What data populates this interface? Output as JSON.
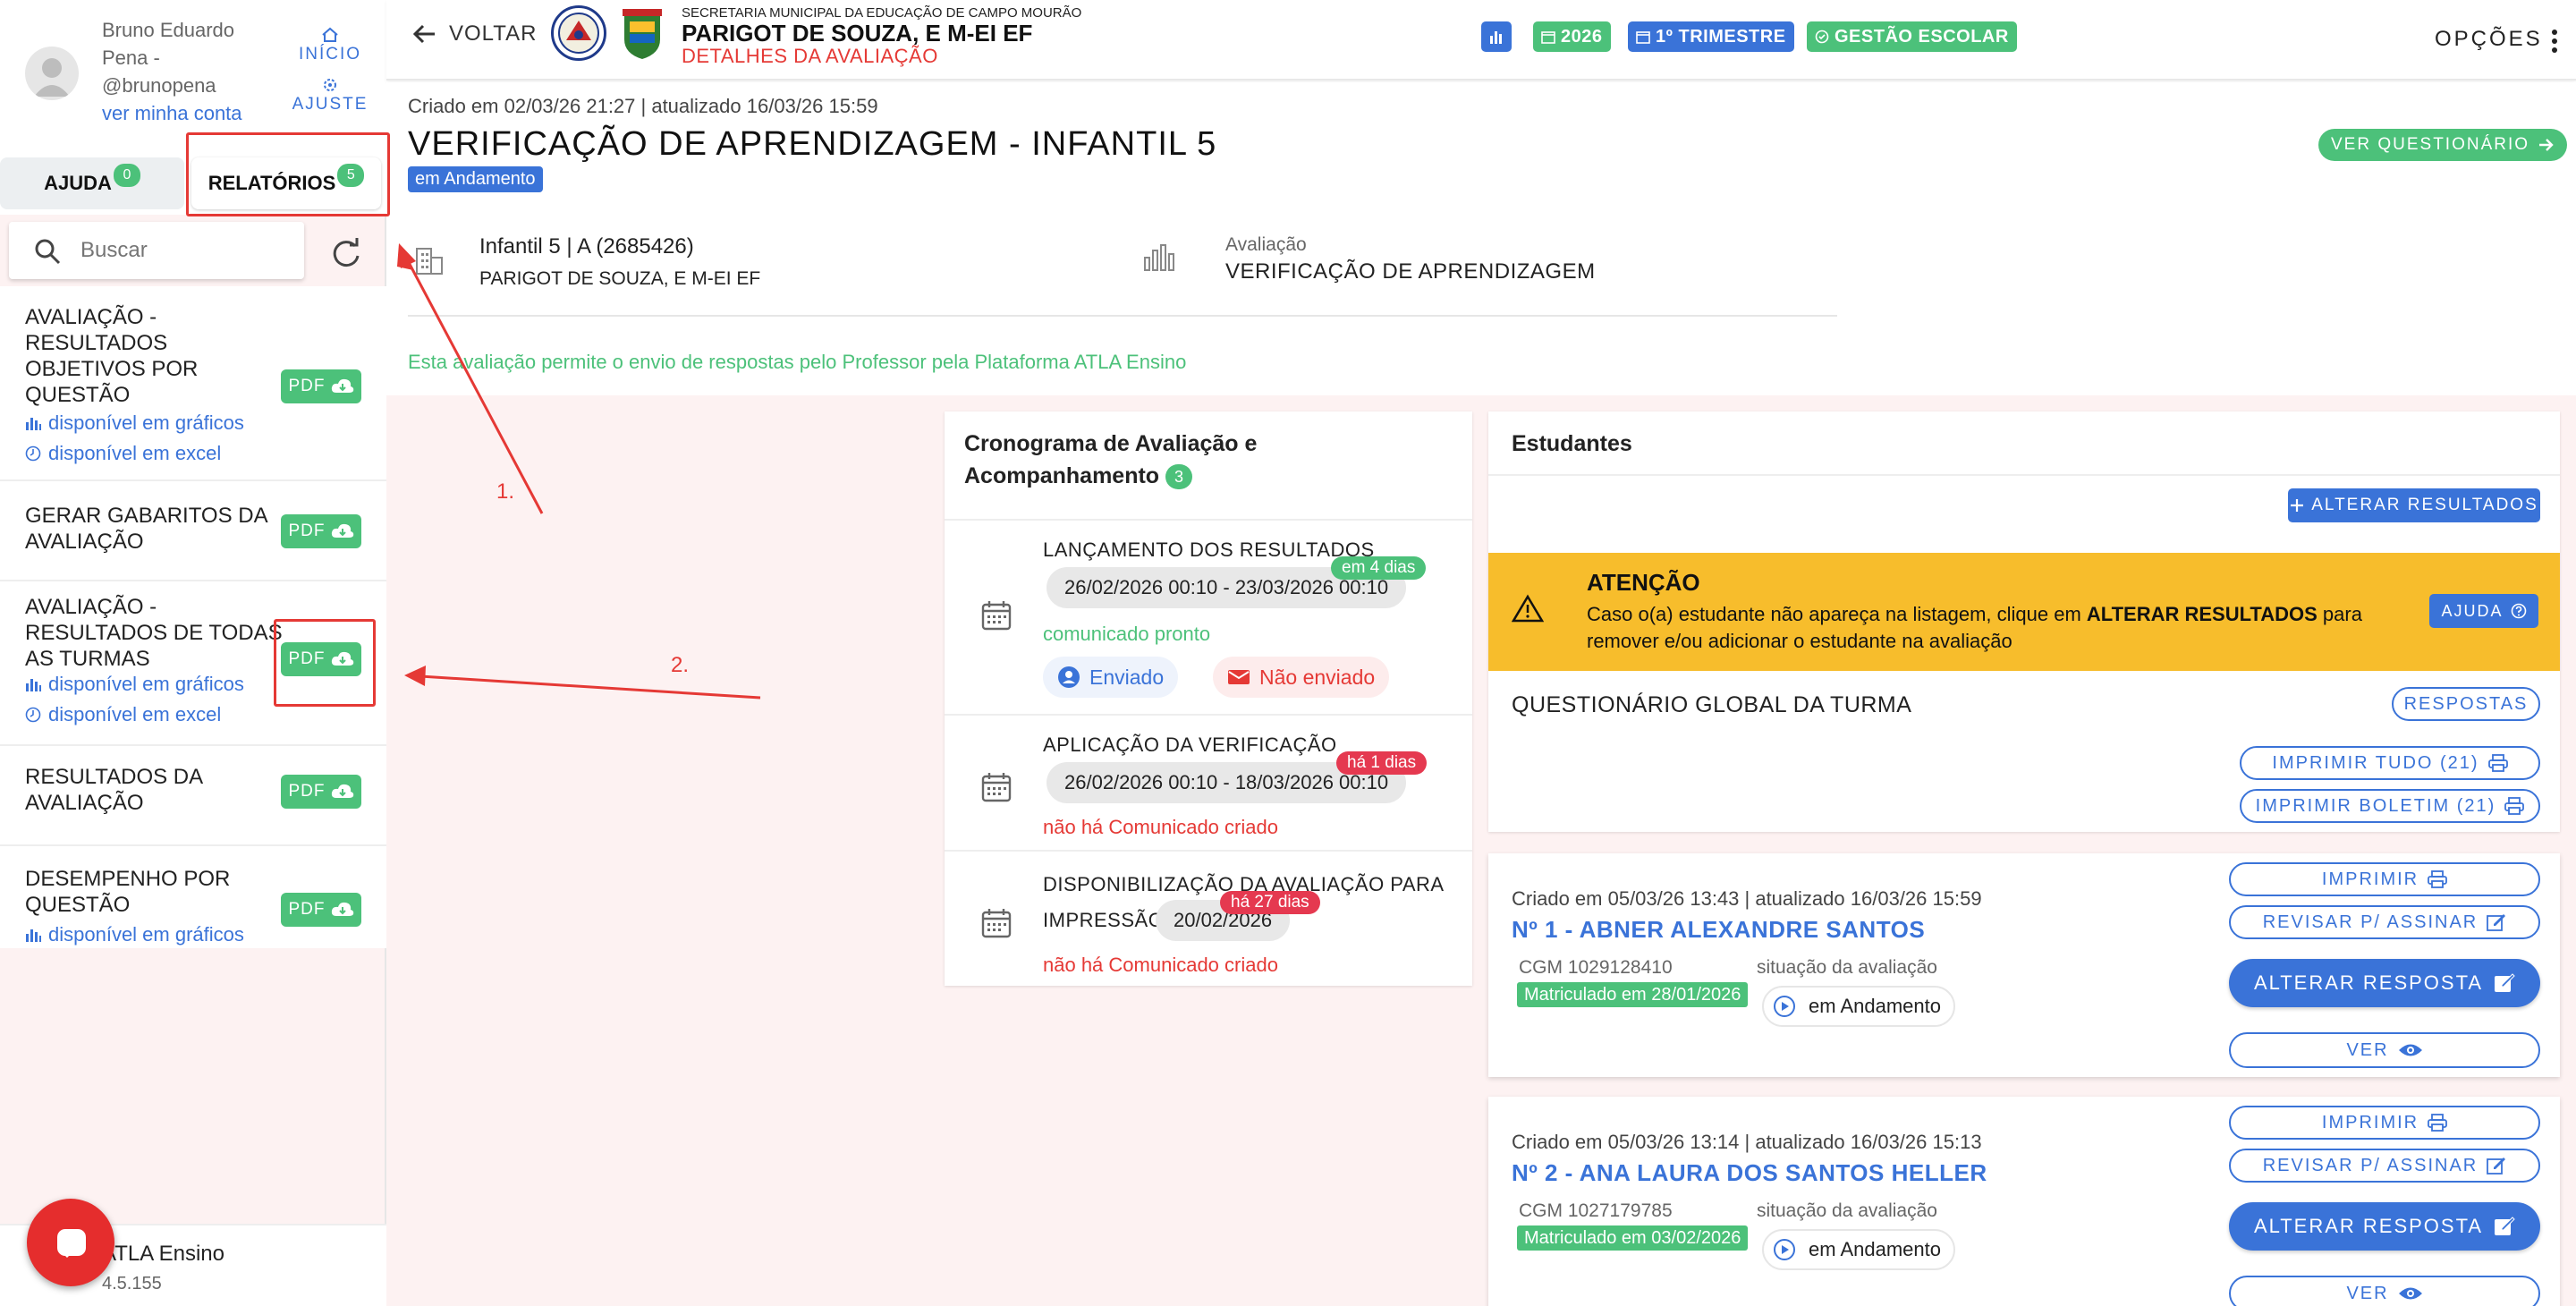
{
  "user": {
    "name": "Bruno Eduardo Pena - @brunopena",
    "account_link": "ver minha conta",
    "home_label": "INÍCIO",
    "settings_label": "AJUSTE"
  },
  "tabs": [
    {
      "label": "AJUDA",
      "count": "0"
    },
    {
      "label": "RELATÓRIOS",
      "count": "5"
    }
  ],
  "search": {
    "placeholder": "Buscar"
  },
  "reports": [
    {
      "title": "AVALIAÇÃO - RESULTADOS OBJETIVOS POR QUESTÃO",
      "pdf": "PDF",
      "graphs": "disponível em gráficos",
      "excel": "disponível em excel"
    },
    {
      "title": "GERAR GABARITOS DA AVALIAÇÃO",
      "pdf": "PDF"
    },
    {
      "title": "AVALIAÇÃO - RESULTADOS DE TODAS AS TURMAS",
      "pdf": "PDF",
      "graphs": "disponível em gráficos",
      "excel": "disponível em excel"
    },
    {
      "title": "RESULTADOS DA AVALIAÇÃO",
      "pdf": "PDF"
    },
    {
      "title": "DESEMPENHO POR QUESTÃO",
      "pdf": "PDF",
      "graphs": "disponível em gráficos"
    }
  ],
  "footer": {
    "app_name": "ATLA Ensino",
    "version": "4.5.155"
  },
  "topbar": {
    "back_label": "VOLTAR",
    "secretariat": "SECRETARIA MUNICIPAL DA EDUCAÇÃO DE CAMPO MOURÃO",
    "school": "PARIGOT DE SOUZA, E M-EI EF",
    "page": "DETALHES DA AVALIAÇÃO",
    "year": "2026",
    "term": "1º TRIMESTRE",
    "management": "GESTÃO ESCOLAR",
    "options": "OPÇÕES"
  },
  "evaluation": {
    "created": "Criado em 02/03/26 21:27 | atualizado 16/03/26 15:59",
    "title": "VERIFICAÇÃO DE APRENDIZAGEM - INFANTIL 5",
    "status": "em Andamento",
    "questionnaire_btn": "VER QUESTIONÁRIO",
    "class_name": "Infantil 5 | A (2685426)",
    "class_school": "PARIGOT DE SOUZA, E M-EI EF",
    "eval_label": "Avaliação",
    "eval_value": "VERIFICAÇÃO DE APRENDIZAGEM",
    "note": "Esta avaliação permite o envio de respostas pelo Professor pela Plataforma ATLA Ensino"
  },
  "schedule": {
    "title": "Cronograma de Avaliação e Acompanhamento",
    "count": "3",
    "items": [
      {
        "title": "LANÇAMENTO DOS RESULTADOS",
        "tag": "em 4 dias",
        "date": "26/02/2026 00:10 - 23/03/2026 00:10",
        "status": "comunicado pronto",
        "sent": "Enviado",
        "not_sent": "Não enviado"
      },
      {
        "title": "APLICAÇÃO DA VERIFICAÇÃO",
        "tag": "há 1 dias",
        "date": "26/02/2026 00:10 - 18/03/2026 00:10",
        "status": "não há Comunicado criado"
      },
      {
        "title": "DISPONIBILIZAÇÃO DA AVALIAÇÃO PARA",
        "title2": "IMPRESSÃO",
        "tag": "há 27 dias",
        "date": "20/02/2026",
        "status": "não há Comunicado criado"
      }
    ]
  },
  "students": {
    "title": "Estudantes",
    "alter_results": "ALTERAR RESULTADOS",
    "alert_title": "ATENÇÃO",
    "alert_pre": "Caso o(a) estudante não apareça na listagem, clique em ",
    "alert_bold": "ALTERAR RESULTADOS",
    "alert_post": " para remover e/ou adicionar o estudante na avaliação",
    "alert_help": "AJUDA",
    "global_title": "QUESTIONÁRIO GLOBAL DA TURMA",
    "answers_btn": "RESPOSTAS",
    "print_all": "IMPRIMIR TUDO (21)",
    "print_report": "IMPRIMIR BOLETIM (21)",
    "list": [
      {
        "created": "Criado em 05/03/26 13:43 | atualizado 16/03/26 15:59",
        "name": "Nº 1 - ABNER ALEXANDRE SANTOS",
        "cgm": "CGM 1029128410",
        "situation_label": "situação da avaliação",
        "enrolled": "Matriculado em 28/01/2026",
        "status": "em Andamento"
      },
      {
        "created": "Criado em 05/03/26 13:14 | atualizado 16/03/26 15:13",
        "name": "Nº 2 - ANA LAURA DOS SANTOS HELLER",
        "cgm": "CGM 1027179785",
        "situation_label": "situação da avaliação",
        "enrolled": "Matriculado em 03/02/2026",
        "status": "em Andamento"
      }
    ],
    "btn_print": "IMPRIMIR",
    "btn_review": "REVISAR P/ ASSINAR",
    "btn_alter": "ALTERAR RESPOSTA",
    "btn_view": "VER"
  },
  "annotations": {
    "step1": "1.",
    "step2": "2."
  },
  "colors": {
    "primary": "#3a73d8",
    "success": "#4cc17a",
    "danger": "#e53935",
    "warning": "#f7bd2c"
  }
}
